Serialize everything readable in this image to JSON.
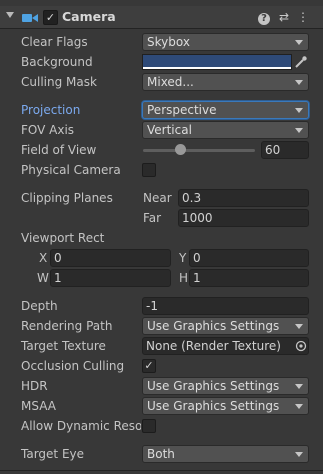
{
  "component": {
    "title": "Camera",
    "enabled_mark": "✓",
    "header_icons": [
      "help-icon",
      "presets-icon",
      "more-menu-icon"
    ],
    "help_glyph": "?",
    "presets_glyph": "⇄",
    "more_glyph": "⋮"
  },
  "fields": {
    "clear_flags": {
      "label": "Clear Flags",
      "value": "Skybox"
    },
    "background": {
      "label": "Background",
      "color": "#2e4a78"
    },
    "culling_mask": {
      "label": "Culling Mask",
      "value": "Mixed..."
    },
    "projection": {
      "label": "Projection",
      "value": "Perspective"
    },
    "fov_axis": {
      "label": "FOV Axis",
      "value": "Vertical"
    },
    "field_of_view": {
      "label": "Field of View",
      "value": "60",
      "slider_fraction": 0.33
    },
    "physical_camera": {
      "label": "Physical Camera",
      "checked": false
    },
    "clipping_planes": {
      "label": "Clipping Planes",
      "near_label": "Near",
      "near": "0.3",
      "far_label": "Far",
      "far": "1000"
    },
    "viewport_rect": {
      "label": "Viewport Rect",
      "x_label": "X",
      "x": "0",
      "y_label": "Y",
      "y": "0",
      "w_label": "W",
      "w": "1",
      "h_label": "H",
      "h": "1"
    },
    "depth": {
      "label": "Depth",
      "value": "-1"
    },
    "rendering_path": {
      "label": "Rendering Path",
      "value": "Use Graphics Settings"
    },
    "target_texture": {
      "label": "Target Texture",
      "value": "None (Render Texture)"
    },
    "occlusion_culling": {
      "label": "Occlusion Culling",
      "checked": true,
      "mark": "✓"
    },
    "hdr": {
      "label": "HDR",
      "value": "Use Graphics Settings"
    },
    "msaa": {
      "label": "MSAA",
      "value": "Use Graphics Settings"
    },
    "allow_dynamic_resolution": {
      "label": "Allow Dynamic Resol",
      "checked": false
    },
    "target_eye": {
      "label": "Target Eye",
      "value": "Both"
    }
  }
}
